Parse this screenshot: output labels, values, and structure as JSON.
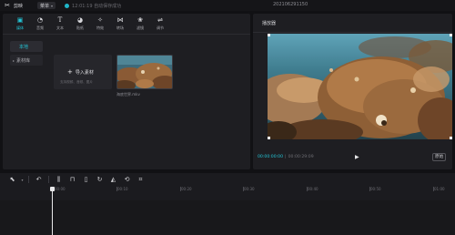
{
  "titlebar": {
    "app_name": "剪映",
    "menu_label": "菜单",
    "save_status": "12:01:19 自动保存成功",
    "project_title": "202106291150"
  },
  "media": {
    "tabs": [
      {
        "label": "媒体",
        "icon": "media-icon",
        "glyph": "▣",
        "active": true
      },
      {
        "label": "音频",
        "icon": "audio-icon",
        "glyph": "◔"
      },
      {
        "label": "文本",
        "icon": "text-icon",
        "glyph": "T"
      },
      {
        "label": "贴纸",
        "icon": "sticker-icon",
        "glyph": "◕"
      },
      {
        "label": "特效",
        "icon": "effects-icon",
        "glyph": "✧"
      },
      {
        "label": "转场",
        "icon": "transition-icon",
        "glyph": "⋈"
      },
      {
        "label": "滤镜",
        "icon": "filter-icon",
        "glyph": "❀"
      },
      {
        "label": "调节",
        "icon": "adjust-icon",
        "glyph": "⇌"
      }
    ],
    "side_local": "本地",
    "side_library": "素材库",
    "import_label": "导入素材",
    "import_hint": "支持视频、音频、图片",
    "clip_name": "海底世界.mkv"
  },
  "player": {
    "title": "播放器",
    "current_time": "00:00:00:00",
    "separator": "|",
    "total_time": "00:00:29:09",
    "ratio_label": "原始"
  },
  "timeline": {
    "tools": [
      {
        "name": "select-icon",
        "glyph": "⬉"
      },
      {
        "name": "undo-icon",
        "glyph": "↶"
      },
      {
        "name": "split-icon",
        "glyph": "⫼"
      },
      {
        "name": "delete-icon",
        "glyph": "🗑"
      },
      {
        "name": "freeze-icon",
        "glyph": "▯"
      },
      {
        "name": "replay-icon",
        "glyph": "↻"
      },
      {
        "name": "mirror-icon",
        "glyph": "◭"
      },
      {
        "name": "rotate-icon",
        "glyph": "⟲"
      },
      {
        "name": "crop-icon",
        "glyph": "⌗"
      }
    ],
    "ruler": [
      "00:00",
      "00:10",
      "00:20",
      "00:30",
      "00:40",
      "00:50",
      "01:00"
    ]
  }
}
